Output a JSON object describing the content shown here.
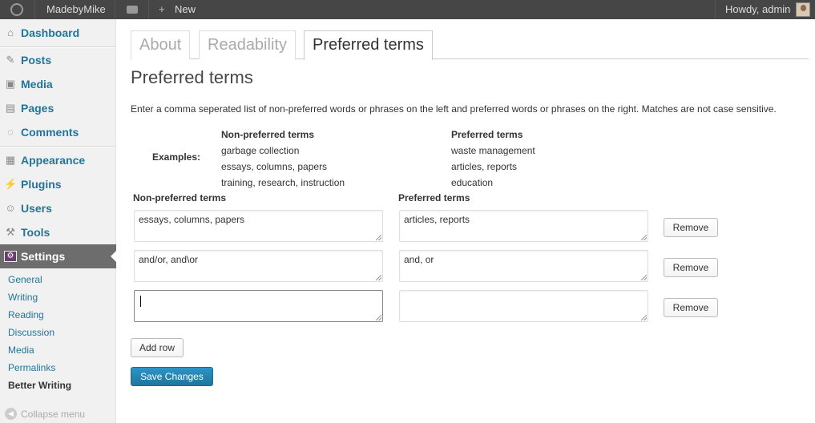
{
  "adminbar": {
    "site_name": "MadebyMike",
    "new_label": "New",
    "howdy": "Howdy, admin"
  },
  "sidebar": {
    "items": [
      {
        "label": "Dashboard",
        "icon": "home-icon"
      },
      {
        "label": "Posts",
        "icon": "pin-icon"
      },
      {
        "label": "Media",
        "icon": "media-icon"
      },
      {
        "label": "Pages",
        "icon": "pages-icon"
      },
      {
        "label": "Comments",
        "icon": "comment-icon"
      },
      {
        "label": "Appearance",
        "icon": "appearance-icon"
      },
      {
        "label": "Plugins",
        "icon": "plugin-icon"
      },
      {
        "label": "Users",
        "icon": "users-icon"
      },
      {
        "label": "Tools",
        "icon": "tools-icon"
      },
      {
        "label": "Settings",
        "icon": "settings-icon"
      }
    ],
    "submenu": [
      "General",
      "Writing",
      "Reading",
      "Discussion",
      "Media",
      "Permalinks",
      "Better Writing"
    ],
    "collapse_label": "Collapse menu"
  },
  "tabs": [
    "About",
    "Readability",
    "Preferred terms"
  ],
  "page": {
    "title": "Preferred terms",
    "description": "Enter a comma seperated list of non-preferred words or phrases on the left and preferred words or phrases on the right. Matches are not case sensitive."
  },
  "examples": {
    "label": "Examples:",
    "non_preferred_header": "Non-preferred terms",
    "preferred_header": "Preferred terms",
    "non_preferred": [
      "garbage collection",
      "essays, columns, papers",
      "training, research, instruction"
    ],
    "preferred": [
      "waste management",
      "articles, reports",
      "education"
    ]
  },
  "form": {
    "non_preferred_header": "Non-preferred terms",
    "preferred_header": "Preferred terms",
    "rows": [
      {
        "non_preferred": "essays, columns, papers",
        "preferred": "articles, reports",
        "remove_label": "Remove"
      },
      {
        "non_preferred": "and/or, and\\or",
        "preferred": "and, or",
        "remove_label": "Remove"
      },
      {
        "non_preferred": "",
        "preferred": "",
        "remove_label": "Remove"
      }
    ],
    "add_row_label": "Add row",
    "save_label": "Save Changes"
  },
  "colors": {
    "adminbar_bg": "#464646",
    "link": "#21759b",
    "active_menu_bg": "#6d6d6d",
    "primary_button": "#21759b"
  }
}
